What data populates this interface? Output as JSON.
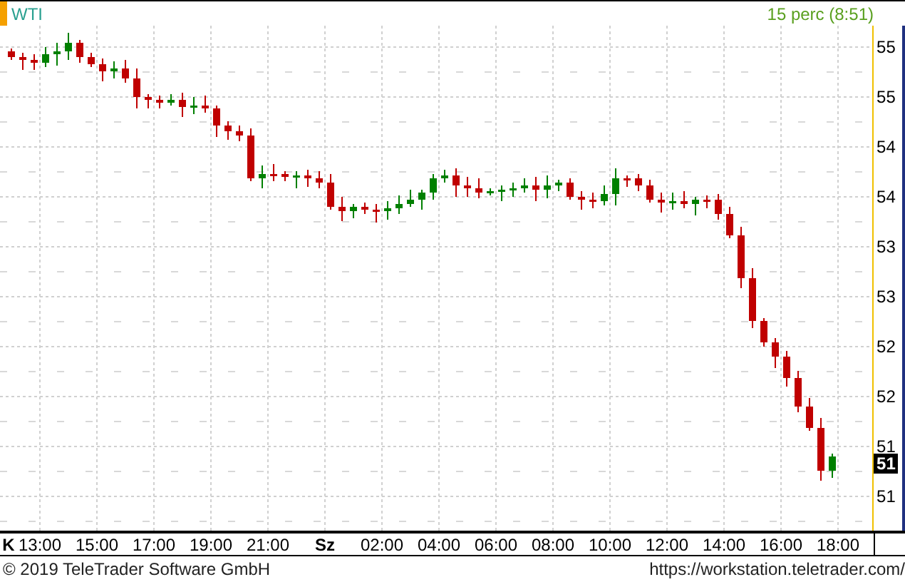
{
  "header": {
    "symbol": "WTI",
    "interval": "15 perc (8:51)"
  },
  "y_axis": {
    "labels": [
      "55",
      "55",
      "54",
      "54",
      "53",
      "53",
      "52",
      "52",
      "51",
      "51"
    ],
    "last_price": "51"
  },
  "x_axis": {
    "labels": [
      {
        "text": "K",
        "kind": "day"
      },
      {
        "text": "13:00",
        "kind": "time"
      },
      {
        "text": "15:00",
        "kind": "time"
      },
      {
        "text": "17:00",
        "kind": "time"
      },
      {
        "text": "19:00",
        "kind": "time"
      },
      {
        "text": "21:00",
        "kind": "time"
      },
      {
        "text": "Sz",
        "kind": "day"
      },
      {
        "text": "02:00",
        "kind": "time"
      },
      {
        "text": "04:00",
        "kind": "time"
      },
      {
        "text": "06:00",
        "kind": "time"
      },
      {
        "text": "08:00",
        "kind": "time"
      },
      {
        "text": "10:00",
        "kind": "time"
      },
      {
        "text": "12:00",
        "kind": "time"
      },
      {
        "text": "14:00",
        "kind": "time"
      },
      {
        "text": "16:00",
        "kind": "time"
      },
      {
        "text": "18:00",
        "kind": "time"
      }
    ]
  },
  "footer": {
    "copyright": "© 2019 TeleTrader Software GmbH",
    "url": "https://workstation.teletrader.com/"
  }
}
